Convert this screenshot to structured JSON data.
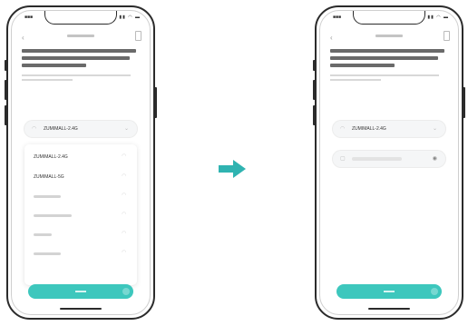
{
  "accent_color": "#3dc7bd",
  "step1": {
    "network_field": {
      "value": "ZUMIMALL-2.4G",
      "icon": "wifi-icon"
    },
    "wifi_list": [
      {
        "name": "ZUMIMALL-2.4G",
        "icon": "wifi-signal-icon"
      },
      {
        "name": "ZUMIMALL-5G",
        "icon": "wifi-signal-icon"
      },
      {
        "name": "",
        "icon": "wifi-signal-icon"
      },
      {
        "name": "",
        "icon": "wifi-signal-icon"
      },
      {
        "name": "",
        "icon": "wifi-signal-icon"
      },
      {
        "name": "",
        "icon": "wifi-signal-icon"
      }
    ]
  },
  "step2": {
    "network_field": {
      "value": "ZUMIMALL-2.4G",
      "icon": "wifi-icon"
    },
    "password_field": {
      "value": "",
      "icon": "lock-icon"
    }
  },
  "flow_arrow_icon": "right-arrow-icon"
}
